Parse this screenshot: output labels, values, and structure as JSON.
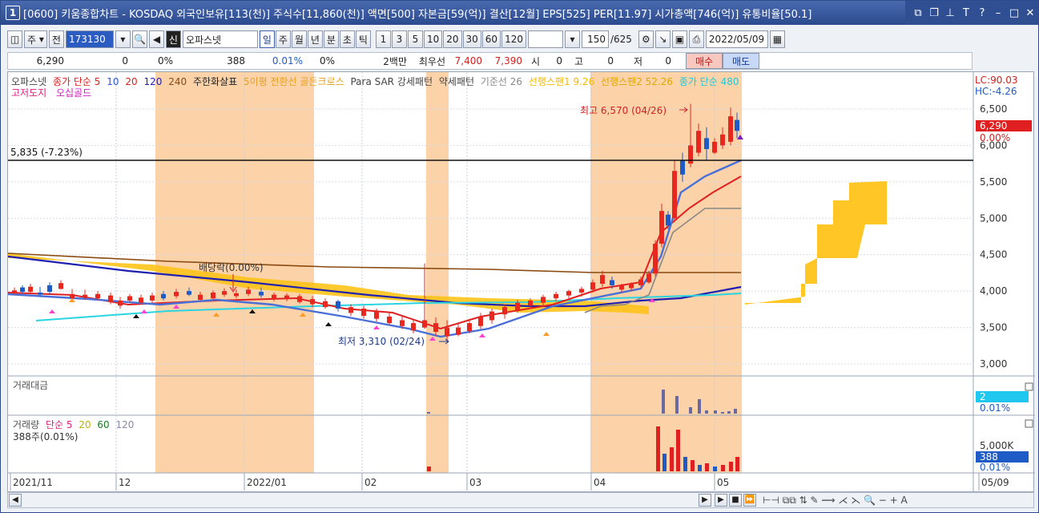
{
  "titlebar": {
    "num": "1",
    "title": "[0600] 키움종합차트 - KOSDAQ 외국인보유[113(천)] 주식수[11,860(천)] 액면[500] 자본금[59(억)] 결산[12월] EPS[525] PER[11.97] 시가총액[746(억)] 유통비율[50.1]"
  },
  "toolbar": {
    "period_sel": "주",
    "prev": "전",
    "code": "173130",
    "credit": "신",
    "stock_name": "오파스넷",
    "tabs": [
      "일",
      "주",
      "월",
      "년",
      "분",
      "초",
      "틱"
    ],
    "active_tab": "일",
    "numbers": [
      "1",
      "3",
      "5",
      "10",
      "20",
      "30",
      "60",
      "120"
    ],
    "count": "150",
    "total": "/625",
    "date": "2022/05/09"
  },
  "quote": {
    "price": "6,290",
    "change": "0",
    "rate": "0%",
    "volume": "388",
    "vrate": "0.01%",
    "v2": "0%",
    "unit": "2백만",
    "best_label": "최우선",
    "ask": "7,400",
    "bid": "7,390",
    "open_label": "시",
    "open": "0",
    "high_label": "고",
    "high": "0",
    "low_label": "저",
    "low": "0",
    "buy": "매수",
    "sell": "매도"
  },
  "legend": {
    "name": "오파스넷",
    "close_ma": "종가 단순 5",
    "ma10": "10",
    "ma20": "20",
    "ma120": "120",
    "ma240": "240",
    "sig": "주한화살표",
    "golden": "5이평 전환선 골든크로스",
    "psar": "Para SAR 강세패턴",
    "weak": "약세패턴",
    "base": "기준선 26",
    "span1": "선행스팬1 9.26",
    "span2": "선행스팬2 52.26",
    "ma480": "종가 단순 480",
    "line2a": "고저도지",
    "line2b": "오십골드",
    "lc": "LC:90.03",
    "hc": "HC:-4.26"
  },
  "annotations": {
    "high": "최고 6,570 (04/26)",
    "low": "최저 3,310 (02/24)",
    "dividend": "배당락(0.00%)",
    "hline": "5,835 (-7.23%)"
  },
  "price_axis": [
    "6,500",
    "6,000",
    "5,500",
    "5,000",
    "4,500",
    "4,000",
    "3,500",
    "3,000"
  ],
  "price_tag": {
    "value": "6,290",
    "pct": "0.00%"
  },
  "amount_panel": {
    "title": "거래대금",
    "tag": "2",
    "pct": "0.01%"
  },
  "volume_panel": {
    "title": "거래량",
    "ma": "단순 5",
    "m20": "20",
    "m60": "60",
    "m120": "120",
    "sub": "388주(0.01%)",
    "axis": "5,000K",
    "tag": "388",
    "pct": "0.01%"
  },
  "x_axis": [
    "2021/11",
    "12",
    "2022/01",
    "02",
    "03",
    "04",
    "05",
    "05/09"
  ],
  "colors": {
    "bull": "#e8281e",
    "bear": "#1e5bc6",
    "shade": "#fcd2a8",
    "cloud": "#ffc31a"
  }
}
